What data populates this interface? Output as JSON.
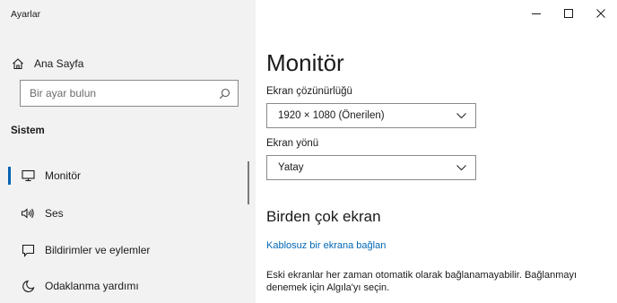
{
  "app": {
    "title": "Ayarlar"
  },
  "sidebar": {
    "home_label": "Ana Sayfa",
    "search_placeholder": "Bir ayar bulun",
    "section_label": "Sistem",
    "items": [
      {
        "label": "Monitör",
        "icon": "monitor-icon",
        "selected": true
      },
      {
        "label": "Ses",
        "icon": "speaker-icon",
        "selected": false
      },
      {
        "label": "Bildirimler ve eylemler",
        "icon": "notification-icon",
        "selected": false
      },
      {
        "label": "Odaklanma yardımı",
        "icon": "moon-icon",
        "selected": false
      }
    ]
  },
  "window_controls": {
    "minimize": "minimize-icon",
    "maximize": "maximize-icon",
    "close": "close-icon"
  },
  "main": {
    "title": "Monitör",
    "resolution": {
      "label": "Ekran çözünürlüğü",
      "value": "1920 × 1080 (Önerilen)"
    },
    "orientation": {
      "label": "Ekran yönü",
      "value": "Yatay"
    },
    "multi_display": {
      "heading": "Birden çok ekran",
      "link": "Kablosuz bir ekrana bağlan",
      "description": "Eski ekranlar her zaman otomatik olarak bağlanamayabilir. Bağlanmayı denemek için Algıla'yı seçin."
    }
  },
  "colors": {
    "accent": "#0063b1",
    "link": "#0066b4",
    "sidebar_bg": "#f2f2f2"
  }
}
